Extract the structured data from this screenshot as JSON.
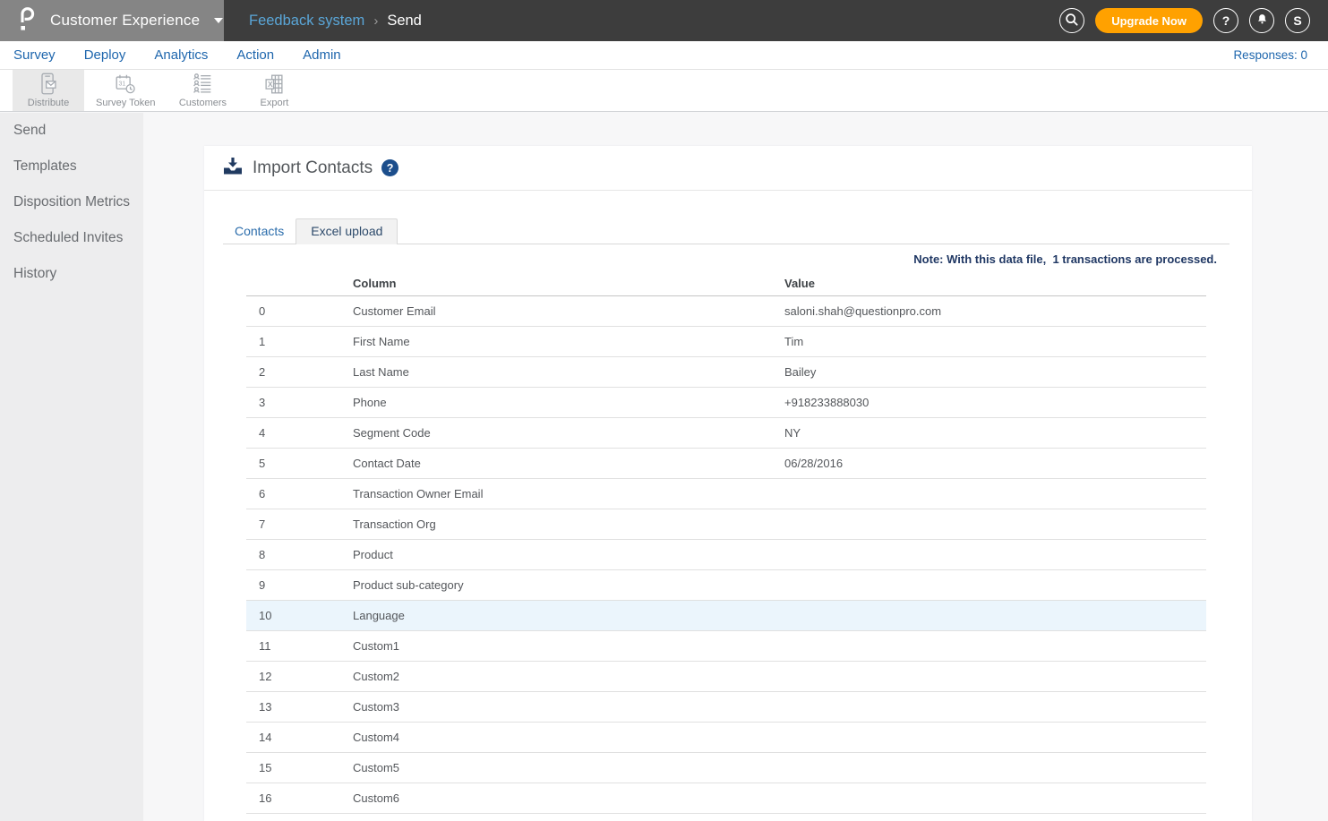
{
  "topbar": {
    "product_name": "Customer Experience",
    "breadcrumb_parent": "Feedback system",
    "breadcrumb_separator": "›",
    "breadcrumb_current": "Send",
    "upgrade_label": "Upgrade Now",
    "help_label": "?",
    "avatar_letter": "S"
  },
  "nav": {
    "items": [
      "Survey",
      "Deploy",
      "Analytics",
      "Action",
      "Admin"
    ],
    "responses": "Responses: 0"
  },
  "toolbar": {
    "items": [
      {
        "label": "Distribute",
        "icon": "phone-envelope-icon",
        "active": true
      },
      {
        "label": "Survey Token",
        "icon": "calendar-clock-icon",
        "active": false
      },
      {
        "label": "Customers",
        "icon": "people-list-icon",
        "active": false
      },
      {
        "label": "Export",
        "icon": "excel-sheet-icon",
        "active": false
      }
    ]
  },
  "sidebar": {
    "items": [
      {
        "label": "Send",
        "active": true
      },
      {
        "label": "Templates",
        "active": false
      },
      {
        "label": "Disposition Metrics",
        "active": false
      },
      {
        "label": "Scheduled Invites",
        "active": false
      },
      {
        "label": "History",
        "active": false
      }
    ]
  },
  "main": {
    "title": "Import Contacts",
    "tabs": [
      {
        "label": "Contacts",
        "active": true
      },
      {
        "label": "Excel upload",
        "active": false
      }
    ],
    "note": "Note: With this data file,  1 transactions are processed.",
    "table": {
      "col_header": "Column",
      "val_header": "Value",
      "rows": [
        {
          "index": "0",
          "column": "Customer Email",
          "value": "saloni.shah@questionpro.com",
          "highlighted": false
        },
        {
          "index": "1",
          "column": "First Name",
          "value": "Tim",
          "highlighted": false
        },
        {
          "index": "2",
          "column": "Last Name",
          "value": "Bailey",
          "highlighted": false
        },
        {
          "index": "3",
          "column": "Phone",
          "value": "+918233888030",
          "highlighted": false
        },
        {
          "index": "4",
          "column": "Segment Code",
          "value": "NY",
          "highlighted": false
        },
        {
          "index": "5",
          "column": "Contact Date",
          "value": "06/28/2016",
          "highlighted": false
        },
        {
          "index": "6",
          "column": "Transaction Owner Email",
          "value": "",
          "highlighted": false
        },
        {
          "index": "7",
          "column": "Transaction Org",
          "value": "",
          "highlighted": false
        },
        {
          "index": "8",
          "column": "Product",
          "value": "",
          "highlighted": false
        },
        {
          "index": "9",
          "column": "Product sub-category",
          "value": "",
          "highlighted": false
        },
        {
          "index": "10",
          "column": "Language",
          "value": "",
          "highlighted": true
        },
        {
          "index": "11",
          "column": "Custom1",
          "value": "",
          "highlighted": false
        },
        {
          "index": "12",
          "column": "Custom2",
          "value": "",
          "highlighted": false
        },
        {
          "index": "13",
          "column": "Custom3",
          "value": "",
          "highlighted": false
        },
        {
          "index": "14",
          "column": "Custom4",
          "value": "",
          "highlighted": false
        },
        {
          "index": "15",
          "column": "Custom5",
          "value": "",
          "highlighted": false
        },
        {
          "index": "16",
          "column": "Custom6",
          "value": "",
          "highlighted": false
        }
      ]
    }
  },
  "colors": {
    "topbar_dark": "#3D3D3D",
    "logo_block_gray": "#858585",
    "accent_orange": "#FFA100",
    "nav_blue": "#1E66AD",
    "breadcrumb_link_blue": "#5AA6D8",
    "note_navy": "#203864",
    "row_highlight_blue": "#EBF5FC",
    "help_dot_navy": "#1C4E8C"
  }
}
